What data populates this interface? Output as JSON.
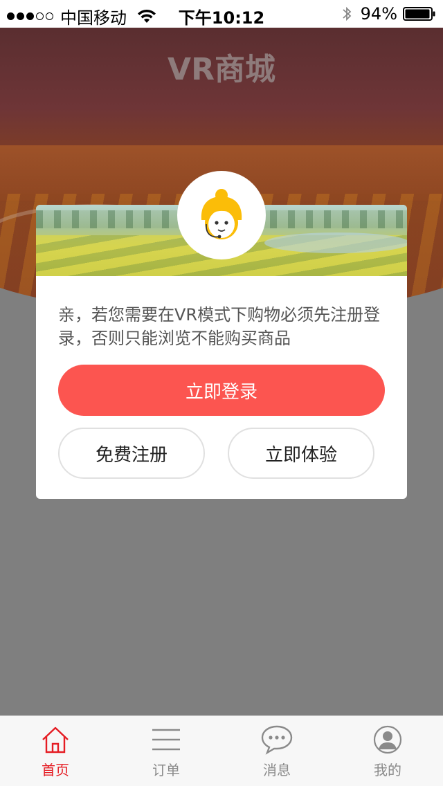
{
  "status_bar": {
    "carrier": "中国移动",
    "time": "下午10:12",
    "battery": "94%",
    "signal_bars_filled": 3,
    "signal_bars_total": 5
  },
  "header": {
    "title": "VR商城"
  },
  "modal": {
    "message": "亲，若您需要在VR模式下购物必须先注册登录，否则只能浏览不能购买商品",
    "login_label": "立即登录",
    "register_label": "免费注册",
    "try_label": "立即体验"
  },
  "tab_bar": {
    "tabs": [
      {
        "label": "首页",
        "icon": "home-icon",
        "active": true
      },
      {
        "label": "订单",
        "icon": "list-icon",
        "active": false
      },
      {
        "label": "消息",
        "icon": "chat-icon",
        "active": false
      },
      {
        "label": "我的",
        "icon": "profile-icon",
        "active": false
      }
    ]
  },
  "colors": {
    "accent": "#fc5550",
    "active_tab": "#e51c23",
    "inactive_tab": "#8a8a8a",
    "overlay": "#7f7f7f",
    "avatar_hair": "#fbbd08"
  }
}
